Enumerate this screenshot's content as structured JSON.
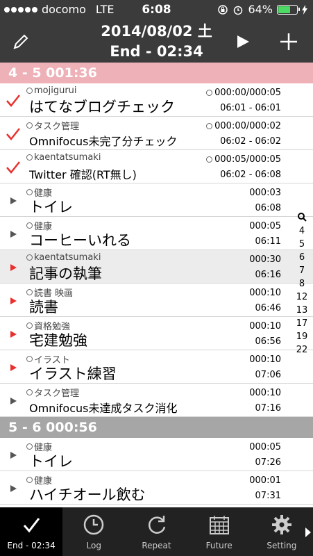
{
  "status": {
    "carrier": "docomo",
    "network": "LTE",
    "time": "6:08",
    "battery": "64%",
    "battery_level": 0.64
  },
  "nav": {
    "date": "2014/08/02 土",
    "end": "End - 02:34"
  },
  "sections": [
    {
      "title": "4 - 5   001:36",
      "ghost": "06:01 - 06:01\n06:01 - 06:01"
    },
    {
      "title": "5 - 6   000:56"
    }
  ],
  "rows": [
    {
      "project": "mojigurui",
      "name": "はてなブログチェック",
      "dur": "000:00/000:05",
      "range": "06:01 - 06:01",
      "mark": "check"
    },
    {
      "project": "タスク管理",
      "name": "Omnifocus未完了分チェック",
      "dur": "000:00/000:02",
      "range": "06:02 - 06:02",
      "mark": "check"
    },
    {
      "project": "kaentatsumaki",
      "name": "Twitter 確認(RT無し)",
      "dur": "000:05/000:05",
      "range": "06:02 - 06:08",
      "mark": "check"
    },
    {
      "project": "健康",
      "name": "トイレ",
      "dur": "000:03",
      "range": "06:08",
      "mark": "gray"
    },
    {
      "project": "健康",
      "name": "コーヒーいれる",
      "dur": "000:05",
      "range": "06:11",
      "mark": "gray"
    },
    {
      "project": "kaentatsumaki",
      "name": "記事の執筆",
      "dur": "000:30",
      "range": "06:16",
      "mark": "red"
    },
    {
      "project": "読書 映画",
      "name": "読書",
      "dur": "000:10",
      "range": "06:46",
      "mark": "red"
    },
    {
      "project": "資格勉強",
      "name": "宅建勉強",
      "dur": "000:10",
      "range": "06:56",
      "mark": "red"
    },
    {
      "project": "イラスト",
      "name": "イラスト練習",
      "dur": "000:10",
      "range": "07:06",
      "mark": "red"
    },
    {
      "project": "タスク管理",
      "name": "Omnifocus未達成タスク消化",
      "dur": "000:10",
      "range": "07:16",
      "mark": "gray"
    },
    {
      "project": "健康",
      "name": "トイレ",
      "dur": "000:05",
      "range": "07:26",
      "mark": "gray"
    },
    {
      "project": "健康",
      "name": "ハイチオール飲む",
      "dur": "000:01",
      "range": "07:31",
      "mark": "gray"
    }
  ],
  "index": [
    "4",
    "5",
    "6",
    "7",
    "8",
    "12",
    "13",
    "17",
    "19",
    "22"
  ],
  "tabs": [
    {
      "label": "End - 02:34",
      "icon": "check-icon"
    },
    {
      "label": "Log",
      "icon": "clock-icon"
    },
    {
      "label": "Repeat",
      "icon": "repeat-icon"
    },
    {
      "label": "Future",
      "icon": "calendar-icon"
    },
    {
      "label": "Setting",
      "icon": "gear-icon"
    }
  ],
  "colors": {
    "bar": "#3b3b3b",
    "pink": "#eeb1b8",
    "gray": "#a6a6a6",
    "accent": "#e8312f",
    "tabbar": "#222222"
  }
}
